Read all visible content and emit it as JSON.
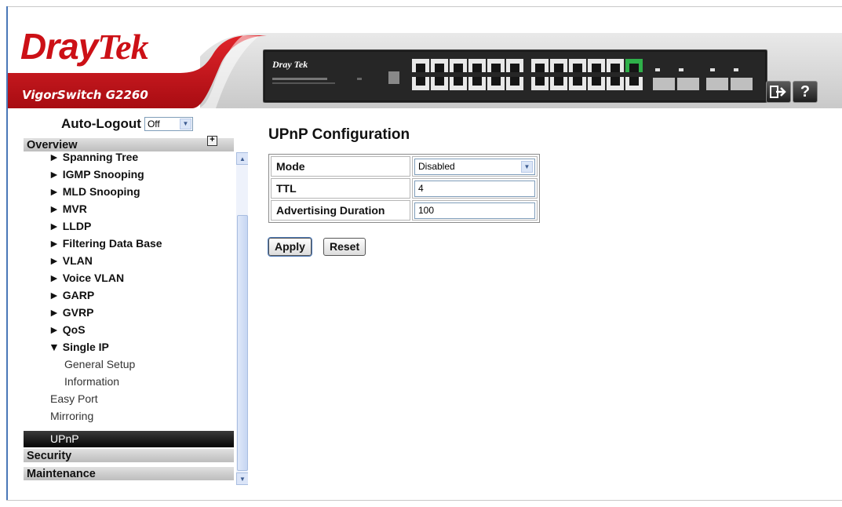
{
  "header": {
    "brand_dray": "Dray",
    "brand_tek": "Tek",
    "model": "VigorSwitch G2260",
    "logout_icon": "logout-arrow-icon",
    "help_label": "?"
  },
  "colors": {
    "brand_red": "#cc1016",
    "active_nav_bg": "#000000",
    "group_header_bg": "#c8c8c8",
    "accent_blue": "#4a78b8"
  },
  "sidebar": {
    "auto_logout_label": "Auto-Logout",
    "auto_logout_value": "Off",
    "groups": [
      "Overview",
      "Security",
      "Maintenance"
    ],
    "items": [
      {
        "label": "► Spanning Tree"
      },
      {
        "label": "► IGMP Snooping"
      },
      {
        "label": "► MLD Snooping"
      },
      {
        "label": "► MVR"
      },
      {
        "label": "► LLDP"
      },
      {
        "label": "► Filtering Data Base"
      },
      {
        "label": "► VLAN"
      },
      {
        "label": "► Voice VLAN"
      },
      {
        "label": "► GARP"
      },
      {
        "label": "► GVRP"
      },
      {
        "label": "► QoS"
      },
      {
        "label": "▼ Single IP"
      },
      {
        "label": "General Setup"
      },
      {
        "label": "Information"
      },
      {
        "label": "Easy Port"
      },
      {
        "label": "Mirroring"
      },
      {
        "label": "UPnP"
      }
    ]
  },
  "main": {
    "title": "UPnP Configuration",
    "rows": [
      {
        "label": "Mode",
        "value": "Disabled"
      },
      {
        "label": "TTL",
        "value": "4"
      },
      {
        "label": "Advertising Duration",
        "value": "100"
      }
    ],
    "apply_label": "Apply",
    "reset_label": "Reset"
  }
}
